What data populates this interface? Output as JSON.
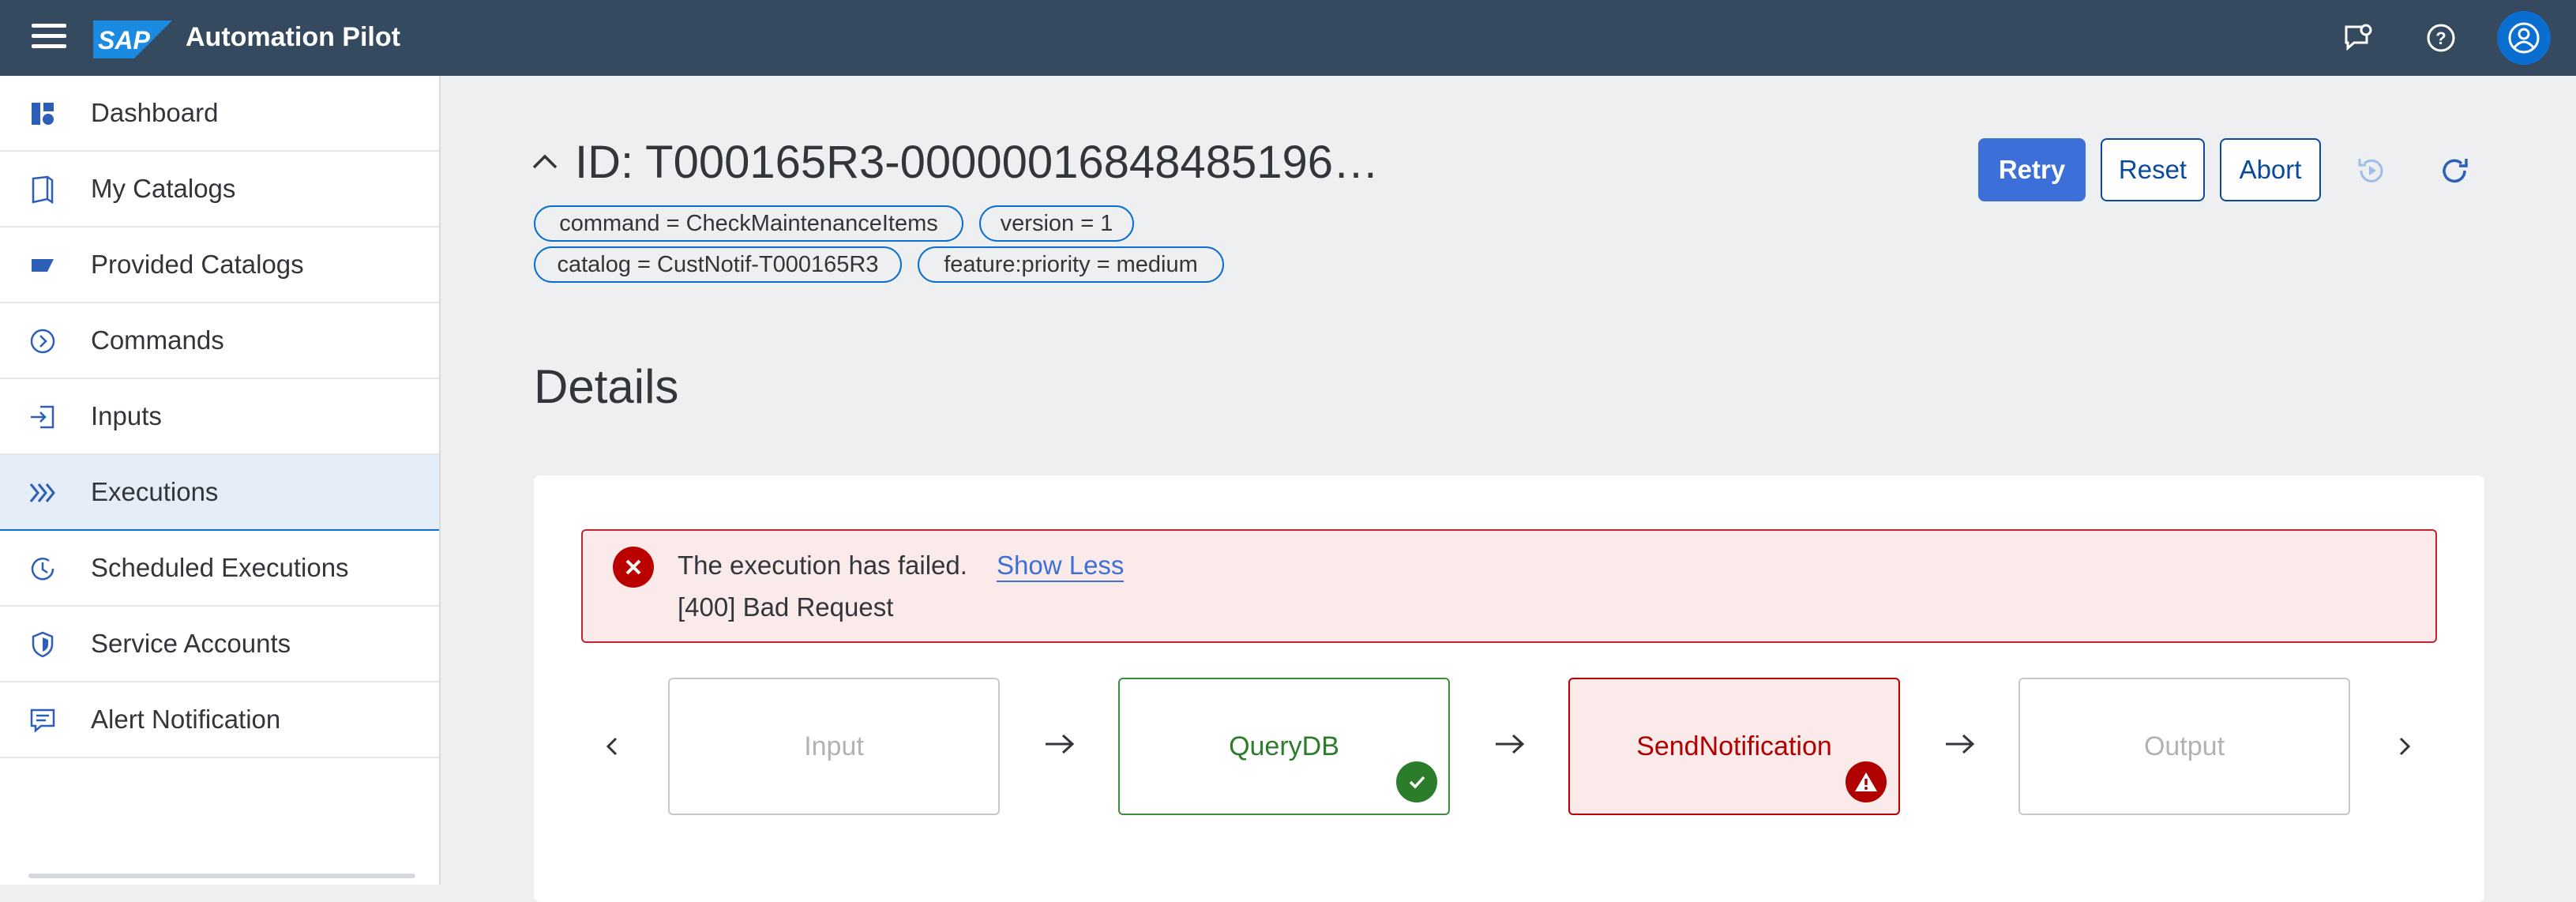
{
  "shell": {
    "app_title": "Automation Pilot",
    "logo_text": "SAP",
    "icons": [
      "menu-icon",
      "feedback-icon",
      "help-icon",
      "user-icon"
    ]
  },
  "sidebar": {
    "items": [
      {
        "label": "Dashboard",
        "icon": "dashboard-icon"
      },
      {
        "label": "My Catalogs",
        "icon": "catalog-icon"
      },
      {
        "label": "Provided Catalogs",
        "icon": "provided-catalog-icon"
      },
      {
        "label": "Commands",
        "icon": "command-icon"
      },
      {
        "label": "Inputs",
        "icon": "input-icon"
      },
      {
        "label": "Executions",
        "icon": "executions-icon",
        "active": true
      },
      {
        "label": "Scheduled Executions",
        "icon": "scheduled-icon"
      },
      {
        "label": "Service Accounts",
        "icon": "shield-icon"
      },
      {
        "label": "Alert Notification",
        "icon": "message-icon"
      }
    ]
  },
  "header": {
    "title": "ID: T000165R3-00000016848485196…",
    "tokens": [
      "command = CheckMaintenanceItems",
      "version = 1",
      "catalog = CustNotif-T000165R3",
      "feature:priority = medium"
    ],
    "actions": {
      "retry": "Retry",
      "reset": "Reset",
      "abort": "Abort"
    }
  },
  "details": {
    "title": "Details",
    "error": {
      "message": "The execution has failed.",
      "link": "Show Less",
      "detail": "[400] Bad Request"
    },
    "steps": [
      {
        "label": "Input",
        "status": "idle"
      },
      {
        "label": "QueryDB",
        "status": "success"
      },
      {
        "label": "SendNotification",
        "status": "error"
      },
      {
        "label": "Output",
        "status": "idle"
      }
    ]
  },
  "colors": {
    "shell": "#354a5f",
    "accent": "#3c6fd8",
    "success": "#2b7d2b",
    "error": "#bb0000"
  }
}
